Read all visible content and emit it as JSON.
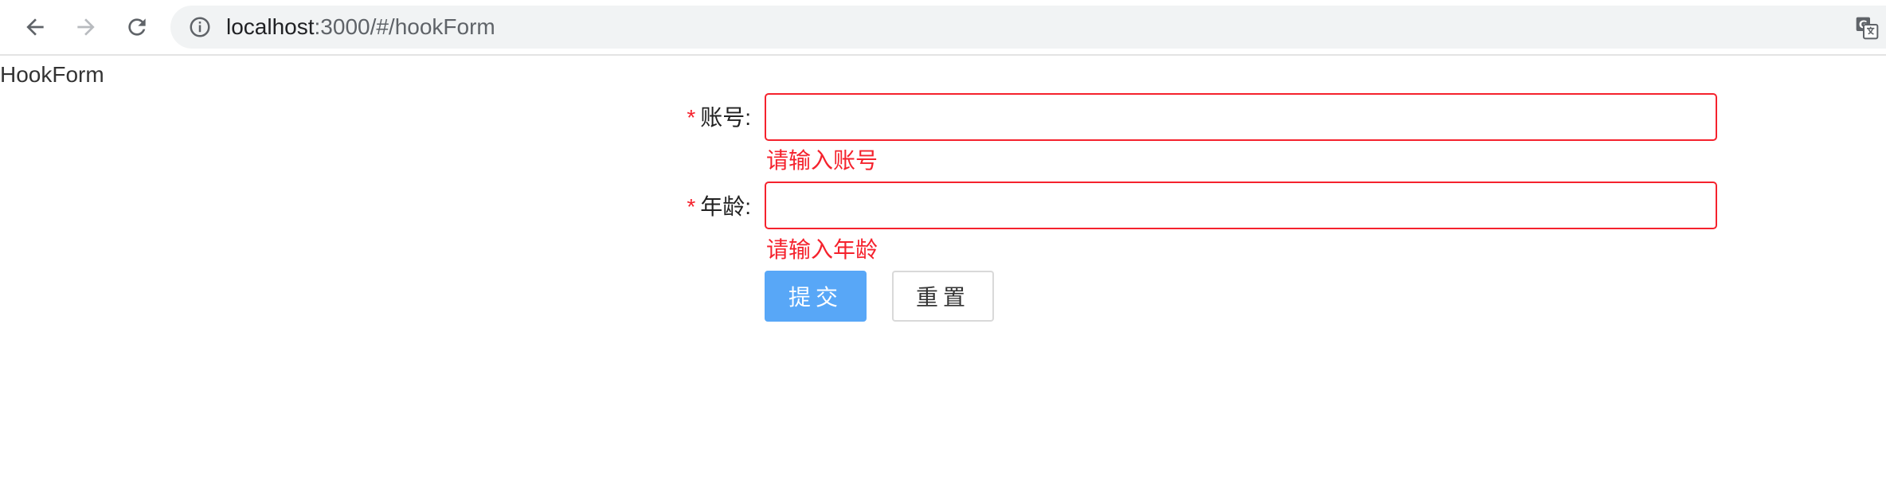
{
  "browser": {
    "url_host": "localhost",
    "url_rest": ":3000/#/hookForm",
    "icons": {
      "back": "arrow-left-icon",
      "forward": "arrow-right-icon",
      "reload": "reload-icon",
      "info": "info-icon",
      "translate": "translate-icon"
    }
  },
  "page": {
    "title": "HookForm"
  },
  "form": {
    "account": {
      "required_mark": "*",
      "label": "账号:",
      "value": "",
      "error": "请输入账号"
    },
    "age": {
      "required_mark": "*",
      "label": "年龄:",
      "value": "",
      "error": "请输入年龄"
    },
    "submit_label": "提交",
    "reset_label": "重置"
  },
  "colors": {
    "error": "#f5222d",
    "primary": "#58a7f7"
  }
}
